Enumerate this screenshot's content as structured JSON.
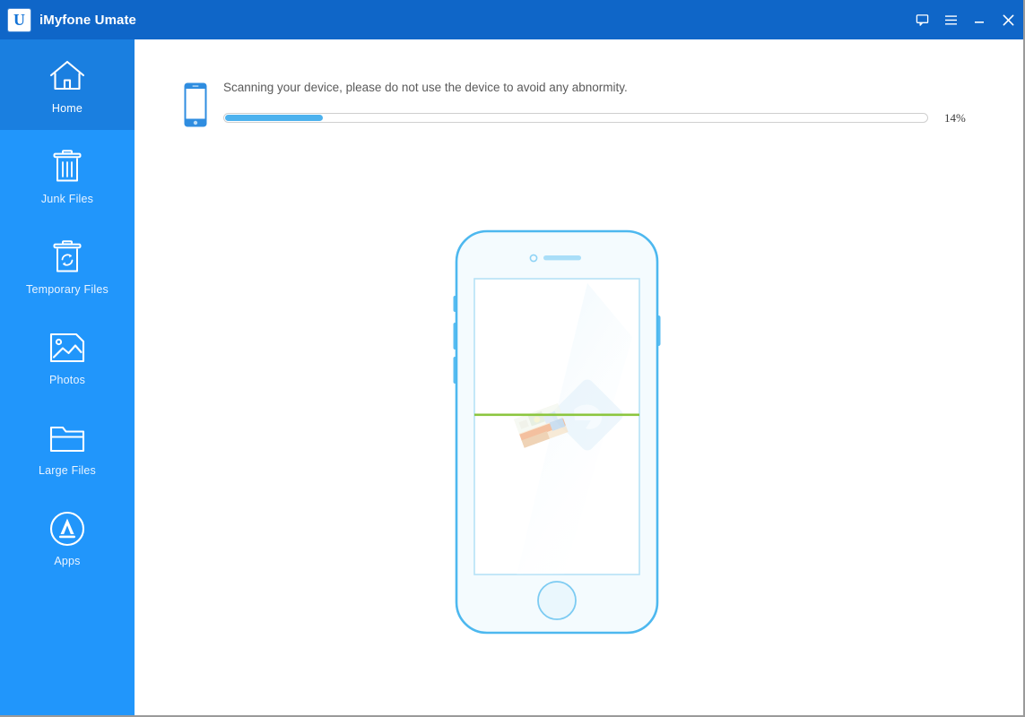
{
  "window": {
    "title": "iMyfone Umate",
    "logo_letter": "U",
    "controls": [
      {
        "name": "feedback-icon",
        "label": "Feedback"
      },
      {
        "name": "menu-icon",
        "label": "Menu"
      },
      {
        "name": "minimize-icon",
        "label": "Minimize"
      },
      {
        "name": "close-icon",
        "label": "Close"
      }
    ]
  },
  "sidebar": {
    "active_index": 0,
    "items": [
      {
        "label": "Home",
        "icon": "home-icon"
      },
      {
        "label": "Junk Files",
        "icon": "trash-icon"
      },
      {
        "label": "Temporary Files",
        "icon": "recycle-trash-icon"
      },
      {
        "label": "Photos",
        "icon": "photo-icon"
      },
      {
        "label": "Large Files",
        "icon": "folder-icon"
      },
      {
        "label": "Apps",
        "icon": "app-store-icon"
      }
    ]
  },
  "main": {
    "status_message": "Scanning your device, please do not use the device to avoid any abnormity.",
    "progress_percent_label": "14%",
    "progress_percent_value": 14,
    "device_icon": "iphone-icon",
    "illustration": {
      "name": "scanning-phone-illustration",
      "scan_line_color": "#8cc63f",
      "outline_color": "#4db8ef",
      "body_fill": "#f2fafe"
    }
  },
  "colors": {
    "titlebar": "#0f66c8",
    "sidebar": "#2196fb",
    "sidebar_active": "#1a7fe0",
    "progress_fill": "#4db2ee",
    "accent": "#4db8ef"
  }
}
